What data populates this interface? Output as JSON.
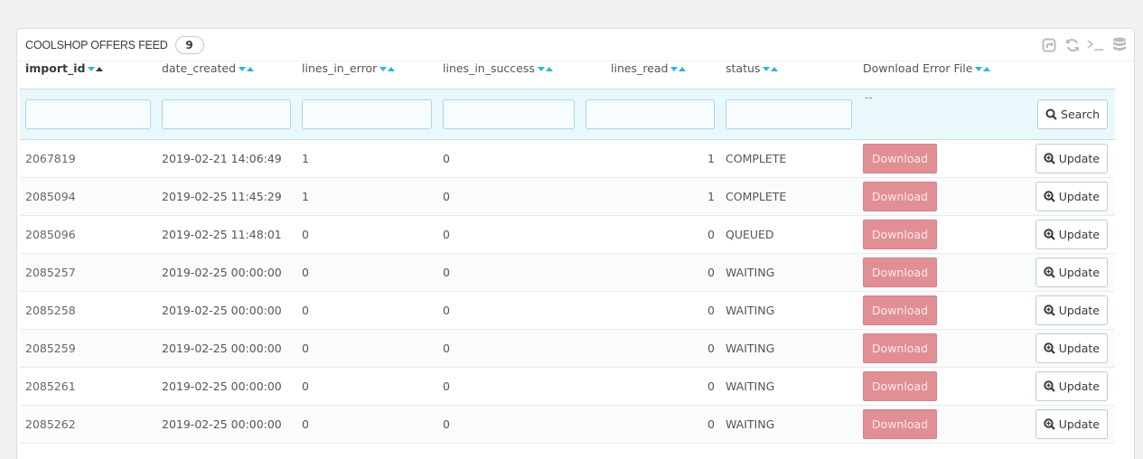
{
  "panel": {
    "title": "COOLSHOP OFFERS FEED",
    "count": "9"
  },
  "toolbar": {
    "icons": [
      "export-icon",
      "refresh-icon",
      "sql-query-icon",
      "database-icon"
    ]
  },
  "columns": [
    {
      "label": "import_id",
      "sorted": true
    },
    {
      "label": "date_created"
    },
    {
      "label": "lines_in_error"
    },
    {
      "label": "lines_in_success"
    },
    {
      "label": "lines_read"
    },
    {
      "label": "status"
    },
    {
      "label": "Download Error File"
    }
  ],
  "filters": {
    "placeholder_dash": "--",
    "search_label": "Search"
  },
  "rows": [
    {
      "import_id": "2067819",
      "date_created": "2019-02-21 14:06:49",
      "lines_in_error": "1",
      "lines_in_success": "0",
      "lines_read": "1",
      "status": "COMPLETE",
      "download": "Download",
      "update": "Update"
    },
    {
      "import_id": "2085094",
      "date_created": "2019-02-25 11:45:29",
      "lines_in_error": "1",
      "lines_in_success": "0",
      "lines_read": "1",
      "status": "COMPLETE",
      "download": "Download",
      "update": "Update"
    },
    {
      "import_id": "2085096",
      "date_created": "2019-02-25 11:48:01",
      "lines_in_error": "0",
      "lines_in_success": "0",
      "lines_read": "0",
      "status": "QUEUED",
      "download": "Download",
      "update": "Update"
    },
    {
      "import_id": "2085257",
      "date_created": "2019-02-25 00:00:00",
      "lines_in_error": "0",
      "lines_in_success": "0",
      "lines_read": "0",
      "status": "WAITING",
      "download": "Download",
      "update": "Update"
    },
    {
      "import_id": "2085258",
      "date_created": "2019-02-25 00:00:00",
      "lines_in_error": "0",
      "lines_in_success": "0",
      "lines_read": "0",
      "status": "WAITING",
      "download": "Download",
      "update": "Update"
    },
    {
      "import_id": "2085259",
      "date_created": "2019-02-25 00:00:00",
      "lines_in_error": "0",
      "lines_in_success": "0",
      "lines_read": "0",
      "status": "WAITING",
      "download": "Download",
      "update": "Update"
    },
    {
      "import_id": "2085261",
      "date_created": "2019-02-25 00:00:00",
      "lines_in_error": "0",
      "lines_in_success": "0",
      "lines_read": "0",
      "status": "WAITING",
      "download": "Download",
      "update": "Update"
    },
    {
      "import_id": "2085262",
      "date_created": "2019-02-25 00:00:00",
      "lines_in_error": "0",
      "lines_in_success": "0",
      "lines_read": "0",
      "status": "WAITING",
      "download": "Download",
      "update": "Update"
    }
  ],
  "colors": {
    "accent": "#25b9d7",
    "download_button": "#e08f95",
    "filter_row_bg": "#eaf7fb"
  }
}
